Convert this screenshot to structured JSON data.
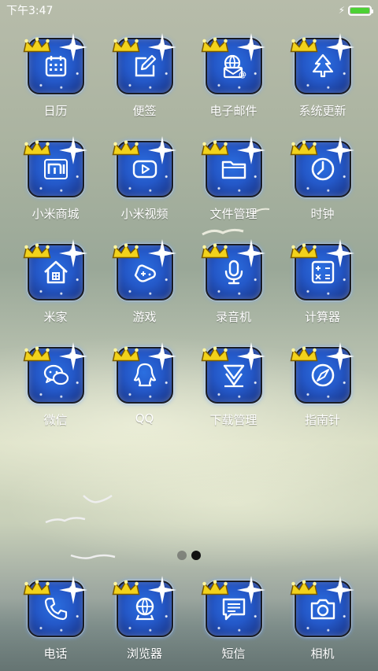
{
  "status_bar": {
    "time": "下午3:47",
    "charging_icon": "bolt-icon",
    "battery_level": 1.0,
    "battery_color": "#4cd134"
  },
  "apps": [
    {
      "label": "日历",
      "icon": "calendar-icon"
    },
    {
      "label": "便签",
      "icon": "notes-icon"
    },
    {
      "label": "电子邮件",
      "icon": "email-icon"
    },
    {
      "label": "系统更新",
      "icon": "update-icon"
    },
    {
      "label": "小米商城",
      "icon": "mi-store-icon"
    },
    {
      "label": "小米视频",
      "icon": "video-icon"
    },
    {
      "label": "文件管理",
      "icon": "folder-icon"
    },
    {
      "label": "时钟",
      "icon": "clock-icon"
    },
    {
      "label": "米家",
      "icon": "home-icon"
    },
    {
      "label": "游戏",
      "icon": "gamepad-icon"
    },
    {
      "label": "录音机",
      "icon": "microphone-icon"
    },
    {
      "label": "计算器",
      "icon": "calculator-icon"
    },
    {
      "label": "微信",
      "icon": "wechat-icon"
    },
    {
      "label": "QQ",
      "icon": "qq-icon"
    },
    {
      "label": "下载管理",
      "icon": "download-icon"
    },
    {
      "label": "指南针",
      "icon": "compass-icon"
    }
  ],
  "pager": {
    "pages": 2,
    "active_page": 2
  },
  "dock": [
    {
      "label": "电话",
      "icon": "phone-icon"
    },
    {
      "label": "浏览器",
      "icon": "browser-icon"
    },
    {
      "label": "短信",
      "icon": "sms-icon"
    },
    {
      "label": "相机",
      "icon": "camera-icon"
    }
  ],
  "theme": {
    "icon_blue": "#2458c8",
    "crown_gold": "#f2d21b",
    "label_color": "#ffffff"
  }
}
